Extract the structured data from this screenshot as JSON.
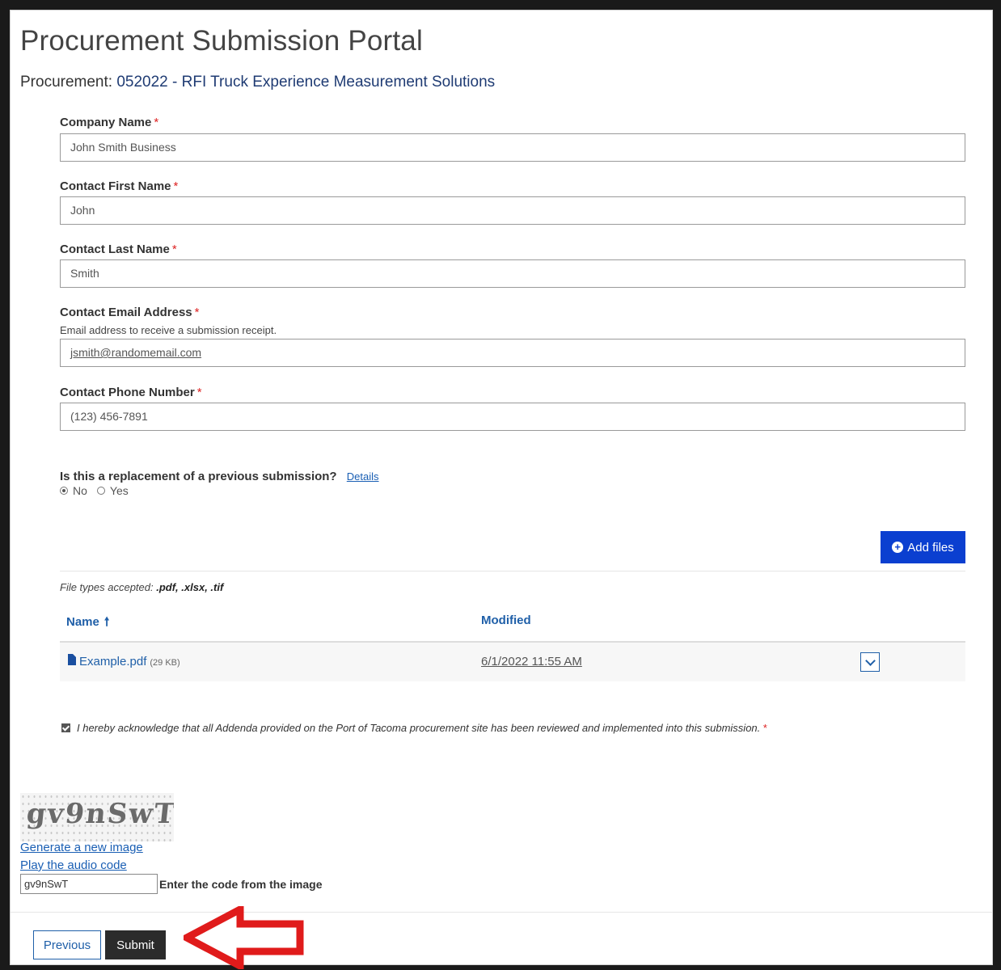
{
  "page": {
    "title": "Procurement Submission Portal",
    "procurement_prefix": "Procurement: ",
    "procurement_name": "052022 - RFI Truck Experience Measurement Solutions"
  },
  "form": {
    "required_mark": "*",
    "company_name": {
      "label": "Company Name",
      "value": "John Smith Business"
    },
    "first_name": {
      "label": "Contact First Name",
      "value": "John"
    },
    "last_name": {
      "label": "Contact Last Name",
      "value": "Smith"
    },
    "email": {
      "label": "Contact Email Address",
      "description": "Email address to receive a submission receipt.",
      "value": "jsmith@randomemail.com"
    },
    "phone": {
      "label": "Contact Phone Number",
      "value": "(123) 456-7891"
    },
    "replacement": {
      "question": "Is this a replacement of a previous submission?",
      "details_link": "Details",
      "options": [
        "No",
        "Yes"
      ],
      "selected": "No"
    }
  },
  "files": {
    "add_button": "Add files",
    "types_prefix": "File types accepted: ",
    "types": ".pdf, .xlsx, .tif",
    "columns": {
      "name": "Name",
      "modified": "Modified"
    },
    "rows": [
      {
        "name": "Example.pdf",
        "size": "(29 KB)",
        "modified": "6/1/2022 11:55 AM"
      }
    ]
  },
  "acknowledgement": {
    "checked": true,
    "text": "I hereby acknowledge that all Addenda provided on the Port of Tacoma procurement site has been reviewed and implemented into this submission.",
    "required_mark": "*"
  },
  "captcha": {
    "image_text": "gv9nSwT",
    "generate_link": "Generate a new image",
    "audio_link": "Play the audio code",
    "input_value": "gv9nSwT",
    "input_label": "Enter the code from the image"
  },
  "buttons": {
    "previous": "Previous",
    "submit": "Submit"
  },
  "colors": {
    "accent": "#0b3fd0",
    "link": "#1f5fa8",
    "submit_bg": "#2b2b2b",
    "annotation_arrow": "#e01b1b"
  },
  "icons": {
    "add_files": "plus-circle-icon",
    "sort": "arrow-up-icon",
    "file": "file-icon",
    "row_menu": "chevron-down-icon",
    "annotation": "red-arrow-icon"
  }
}
